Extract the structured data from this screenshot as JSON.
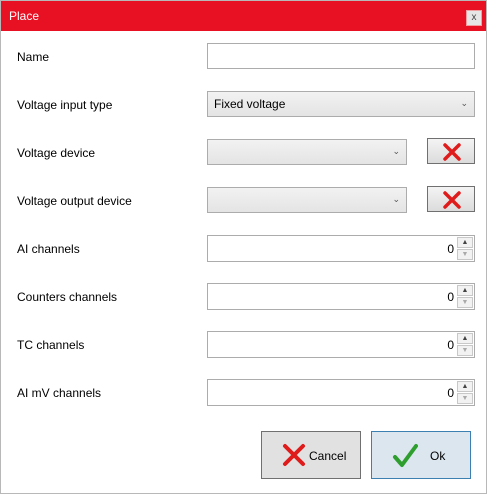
{
  "window": {
    "title": "Place",
    "close_label": "x"
  },
  "fields": {
    "name": {
      "label": "Name",
      "value": ""
    },
    "voltage_input_type": {
      "label": "Voltage input type",
      "selected": "Fixed voltage"
    },
    "voltage_device": {
      "label": "Voltage device",
      "selected": ""
    },
    "voltage_output_device": {
      "label": "Voltage output device",
      "selected": ""
    },
    "ai_channels": {
      "label": "AI channels",
      "value": "0"
    },
    "counters_channels": {
      "label": "Counters channels",
      "value": "0"
    },
    "tc_channels": {
      "label": "TC channels",
      "value": "0"
    },
    "ai_mv_channels": {
      "label": "AI mV channels",
      "value": "0"
    }
  },
  "buttons": {
    "cancel": "Cancel",
    "ok": "Ok"
  },
  "icons": {
    "clear": "red-x-icon",
    "cancel": "red-x-icon",
    "ok": "green-check-icon"
  },
  "colors": {
    "titlebar": "#e81123",
    "x_icon": "#e01b1b",
    "check_icon": "#2e9e2e"
  }
}
